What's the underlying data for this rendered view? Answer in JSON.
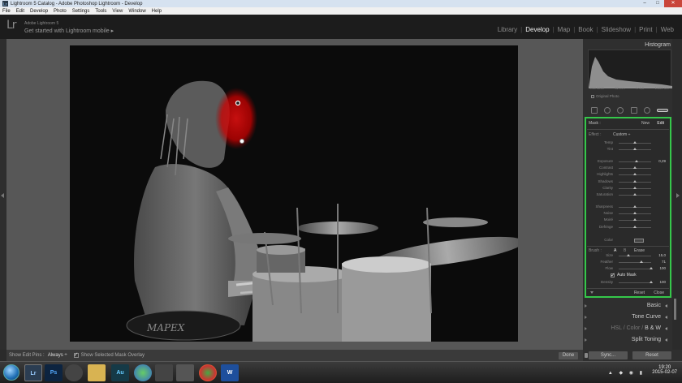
{
  "window": {
    "title": "Lightroom 5 Catalog - Adobe Photoshop Lightroom - Develop",
    "controls": [
      "–",
      "□",
      "✕"
    ]
  },
  "menu": [
    "File",
    "Edit",
    "Develop",
    "Photo",
    "Settings",
    "Tools",
    "View",
    "Window",
    "Help"
  ],
  "header": {
    "logo": "Lr",
    "app_name": "Adobe Lightroom 5",
    "mobile_link": "Get started with Lightroom mobile ▸",
    "modules": [
      "Library",
      "Develop",
      "Map",
      "Book",
      "Slideshow",
      "Print",
      "Web"
    ],
    "active_module": "Develop"
  },
  "toolbar": {
    "show_edit_pins_label": "Show Edit Pins :",
    "show_edit_pins_value": "Always ÷",
    "overlay_label": "Show Selected Mask Overlay",
    "done_label": "Done"
  },
  "histogram": {
    "title": "Histogram",
    "meta": [
      "ISO 3200",
      "52 mm",
      "f / 4,0",
      "1/160 sec"
    ],
    "original_photo": "Original Photo"
  },
  "mask": {
    "label": "Mask :",
    "new": "New",
    "edit": "Edit",
    "effect_label": "Effect :",
    "effect_value": "Custom ÷",
    "sliders_a": [
      {
        "label": "Temp",
        "pos": 0.5,
        "value": ""
      },
      {
        "label": "Tint",
        "pos": 0.5,
        "value": ""
      }
    ],
    "sliders_b": [
      {
        "label": "Exposure",
        "pos": 0.56,
        "value": "0,29"
      },
      {
        "label": "Contrast",
        "pos": 0.5,
        "value": ""
      },
      {
        "label": "Highlights",
        "pos": 0.5,
        "value": ""
      },
      {
        "label": "Shadows",
        "pos": 0.5,
        "value": ""
      },
      {
        "label": "Clarity",
        "pos": 0.5,
        "value": ""
      },
      {
        "label": "Saturation",
        "pos": 0.5,
        "value": ""
      }
    ],
    "sliders_c": [
      {
        "label": "Sharpness",
        "pos": 0.5,
        "value": ""
      },
      {
        "label": "Noise",
        "pos": 0.5,
        "value": ""
      },
      {
        "label": "Moiré",
        "pos": 0.5,
        "value": ""
      },
      {
        "label": "Defringe",
        "pos": 0.5,
        "value": ""
      }
    ],
    "color_label": "Color",
    "brush_label": "Brush :",
    "brush_a": "A",
    "brush_b": "B",
    "brush_erase": "Erase",
    "brush_sliders": [
      {
        "label": "Size",
        "pos": 0.3,
        "value": "15,0"
      },
      {
        "label": "Feather",
        "pos": 0.71,
        "value": "71"
      },
      {
        "label": "Flow",
        "pos": 1.0,
        "value": "100"
      }
    ],
    "auto_mask": "Auto Mask",
    "density": {
      "label": "Density",
      "pos": 1.0,
      "value": "100"
    },
    "reset": "Reset",
    "close": "Close"
  },
  "panels": {
    "basic": "Basic",
    "tone_curve": "Tone Curve",
    "hsl": "HSL",
    "color": "Color",
    "bw": "B & W",
    "split_toning": "Split Toning"
  },
  "sync": {
    "sync_label": "Sync...",
    "reset_label": "Reset"
  },
  "taskbar": {
    "icons": [
      "Lr",
      "Ps",
      "",
      "",
      "Au",
      "",
      "",
      "",
      "",
      "W"
    ],
    "time": "19:20",
    "date": "2015-02-07"
  },
  "colors": {
    "mask_highlight": "#35c84a",
    "mask_overlay": "#d01010"
  }
}
